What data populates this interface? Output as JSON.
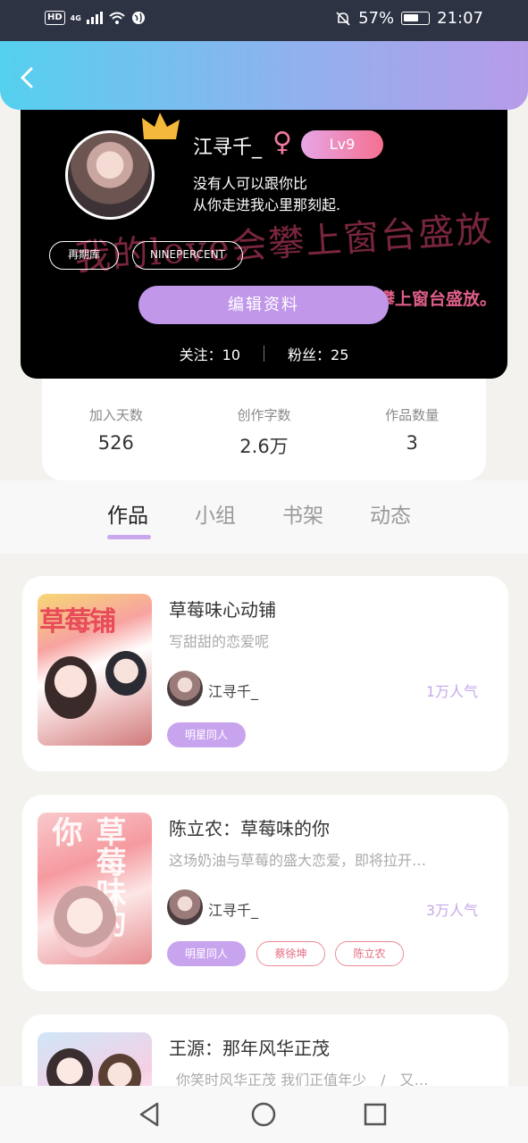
{
  "status_bar": {
    "network": "4G",
    "hd": "HD",
    "battery_percent": "57%",
    "time": "21:07"
  },
  "profile": {
    "username": "江寻千_",
    "gender_symbol": "♀",
    "level": "Lv9",
    "bio": "没有人可以跟你比\n 从你走进我心里那刻起.",
    "tags": [
      "再期库",
      "NINEPERCENT"
    ],
    "background_text": "我的love会攀上窗台盛放",
    "background_text_2": "攀上窗台盛放。",
    "edit_button": "编辑资料",
    "following_label": "关注：",
    "following": "10",
    "fans_label": "粉丝：",
    "fans": "25"
  },
  "stats": [
    {
      "label": "加入天数",
      "value": "526"
    },
    {
      "label": "创作字数",
      "value": "2.6万"
    },
    {
      "label": "作品数量",
      "value": "3"
    }
  ],
  "tabs": [
    {
      "label": "作品",
      "active": true
    },
    {
      "label": "小组",
      "active": false
    },
    {
      "label": "书架",
      "active": false
    },
    {
      "label": "动态",
      "active": false
    }
  ],
  "works": [
    {
      "title": "草莓味心动铺",
      "cover_text": "草莓铺",
      "description": "写甜甜的恋爱呢",
      "author": "江寻千_",
      "popularity": "1万人气",
      "tags": [
        {
          "label": "明星同人",
          "style": "fill"
        }
      ]
    },
    {
      "title": "陈立农：草莓味的你",
      "cover_text": "草莓味的你",
      "description": "这场奶油与草莓的盛大恋爱，即将拉开…",
      "author": "江寻千_",
      "popularity": "3万人气",
      "tags": [
        {
          "label": "明星同人",
          "style": "fill"
        },
        {
          "label": "蔡徐坤",
          "style": "outline"
        },
        {
          "label": "陈立农",
          "style": "outline"
        }
      ]
    },
    {
      "title": "王源：那年风华正茂",
      "cover_text": "",
      "description": "_你笑时风华正茂 我们正值年少　/　又…",
      "author": "",
      "popularity": "",
      "tags": []
    }
  ],
  "colors": {
    "accent": "#c9a4ee",
    "header_start": "#55d0ef",
    "header_end": "#b79be9",
    "tag_outline": "#ec8b98"
  },
  "icons": [
    "back-arrow-icon",
    "crown-icon",
    "nav-back-icon",
    "nav-home-icon",
    "nav-recents-icon"
  ]
}
